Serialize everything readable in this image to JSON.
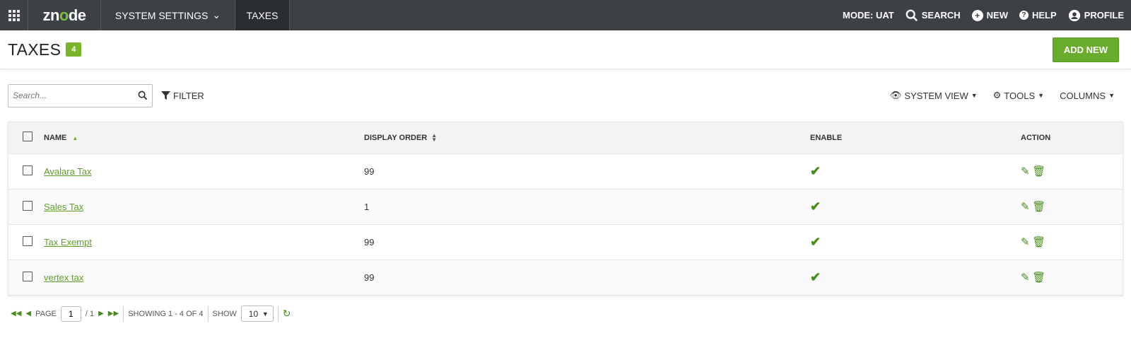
{
  "nav": {
    "logo": "znode",
    "menu": "SYSTEM SETTINGS",
    "active_tab": "TAXES",
    "mode": "MODE: UAT",
    "search": "SEARCH",
    "new": "NEW",
    "help": "HELP",
    "profile": "PROFILE"
  },
  "header": {
    "title": "TAXES",
    "count": "4",
    "add_new": "ADD NEW"
  },
  "toolbar": {
    "search_placeholder": "Search...",
    "filter": "FILTER",
    "system_view": "SYSTEM VIEW",
    "tools": "TOOLS",
    "columns": "COLUMNS"
  },
  "table": {
    "columns": [
      "NAME",
      "DISPLAY ORDER",
      "ENABLE",
      "ACTION"
    ],
    "rows": [
      {
        "name": "Avalara Tax",
        "order": "99",
        "enabled": true
      },
      {
        "name": "Sales Tax",
        "order": "1",
        "enabled": true
      },
      {
        "name": "Tax Exempt",
        "order": "99",
        "enabled": true
      },
      {
        "name": "vertex tax",
        "order": "99",
        "enabled": true
      }
    ]
  },
  "pager": {
    "page_label": "PAGE",
    "page": "1",
    "total": "/ 1",
    "showing": "SHOWING 1 - 4 OF 4",
    "show_label": "SHOW",
    "show_value": "10"
  },
  "colors": {
    "accent": "#6aad2c",
    "nav_bg": "#3d4045"
  }
}
